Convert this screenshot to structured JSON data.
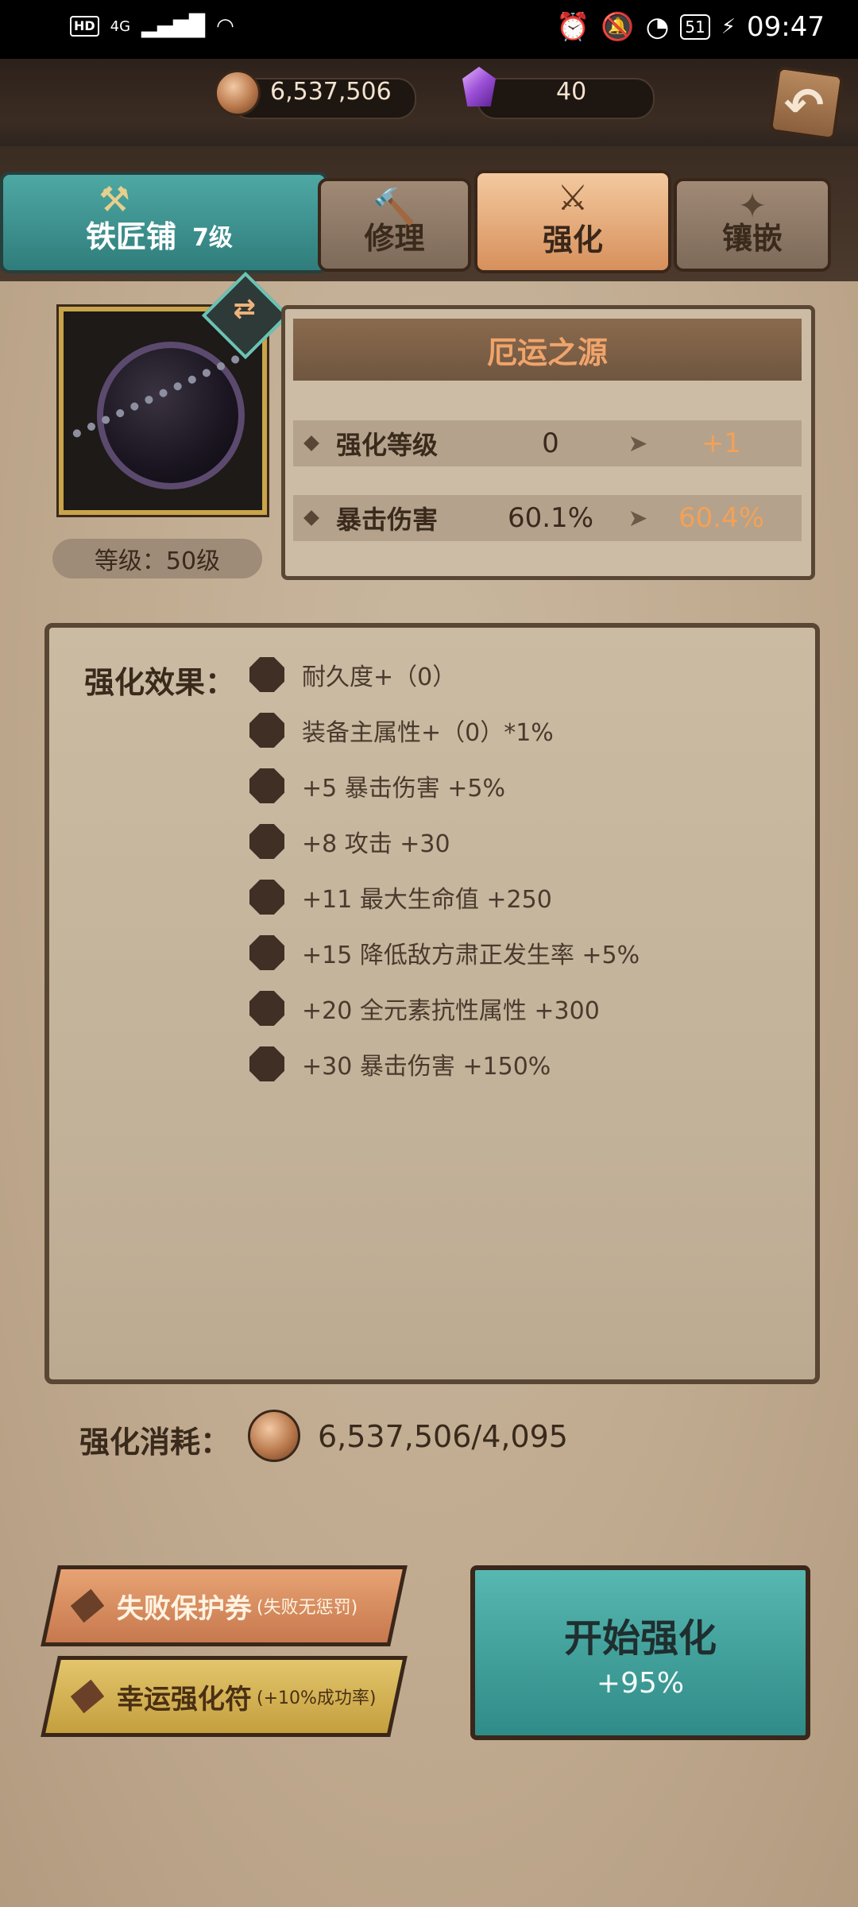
{
  "status_bar": {
    "left_text": "4G",
    "battery": "51",
    "time": "09:47"
  },
  "resources": {
    "coins": "6,537,506",
    "gems": "40"
  },
  "tabs": {
    "smith": {
      "label": "铁匠铺",
      "level": "7级"
    },
    "repair": "修理",
    "enhance": "强化",
    "inlay": "镶嵌"
  },
  "item": {
    "name": "厄运之源",
    "level": "等级：50级"
  },
  "stats": [
    {
      "label": "强化等级",
      "current": "0",
      "next": "+1"
    },
    {
      "label": "暴击伤害",
      "current": "60.1%",
      "next": "60.4%"
    }
  ],
  "effects": {
    "title": "强化效果：",
    "items": [
      "耐久度+（0）",
      "装备主属性+（0）*1%",
      "+5  暴击伤害 +5%",
      "+8  攻击 +30",
      "+11  最大生命值 +250",
      "+15  降低敌方肃正发生率 +5%",
      "+20  全元素抗性属性 +300",
      "+30  暴击伤害 +150%"
    ]
  },
  "cost": {
    "label": "强化消耗：",
    "value": "6,537,506/4,095"
  },
  "buttons": {
    "protect": {
      "main": "失败保护券",
      "sub": "(失败无惩罚)"
    },
    "lucky": {
      "main": "幸运强化符",
      "sub": "(+10%成功率)"
    },
    "start": {
      "main": "开始强化",
      "sub": "+95%"
    }
  },
  "colors": {
    "accent_orange": "#f4a156",
    "teal": "#4ea8a4"
  }
}
